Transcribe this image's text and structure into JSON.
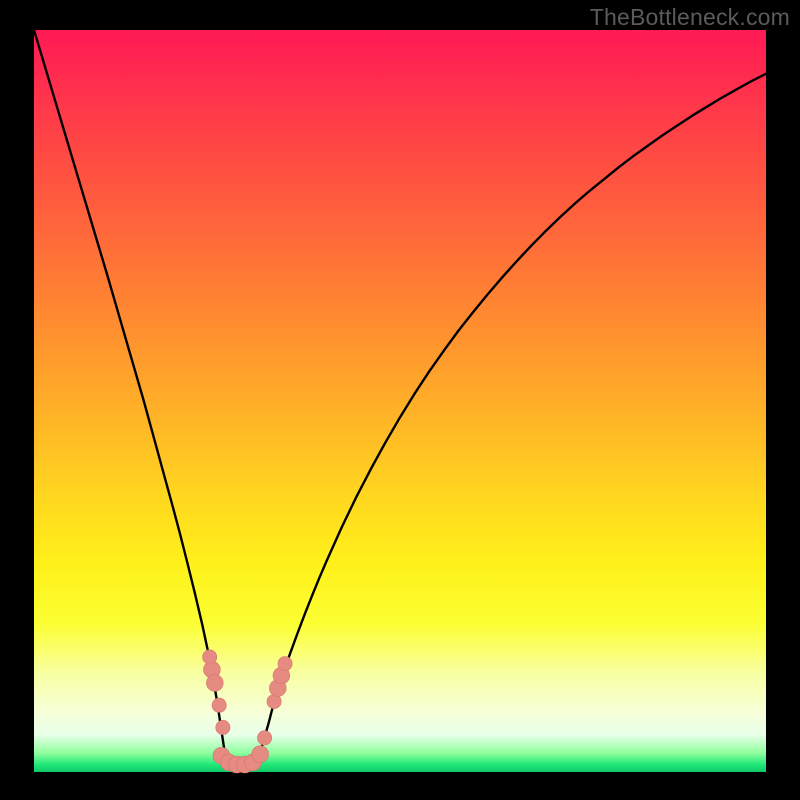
{
  "watermark": "TheBottleneck.com",
  "colors": {
    "frame": "#000000",
    "curve_stroke": "#000000",
    "marker_fill": "#e58b82",
    "marker_stroke": "#d8746b"
  },
  "chart_data": {
    "type": "line",
    "title": "",
    "xlabel": "",
    "ylabel": "",
    "xlim": [
      0,
      100
    ],
    "ylim": [
      0,
      100
    ],
    "grid": false,
    "x": [
      0,
      1,
      2,
      3,
      4,
      5,
      6,
      7,
      8,
      9,
      10,
      11,
      12,
      13,
      14,
      15,
      16,
      17,
      18,
      19,
      20,
      21,
      22,
      23,
      24,
      25,
      26,
      27,
      28,
      29,
      30,
      31,
      32,
      33,
      34,
      35,
      36,
      37,
      38,
      39,
      40,
      42,
      44,
      46,
      48,
      50,
      52,
      54,
      56,
      58,
      60,
      62,
      64,
      66,
      68,
      70,
      72,
      74,
      76,
      78,
      80,
      82,
      84,
      86,
      88,
      90,
      92,
      94,
      96,
      98,
      100
    ],
    "y": [
      100,
      96.7,
      93.4,
      90.1,
      86.8,
      83.5,
      80.2,
      76.9,
      73.6,
      70.3,
      67,
      63.6,
      60.2,
      56.8,
      53.4,
      50,
      46.4,
      42.8,
      39.2,
      35.6,
      31.9,
      28,
      24,
      19.8,
      15.2,
      9.6,
      3,
      1,
      1,
      1,
      1.6,
      3,
      6.4,
      10.2,
      13.2,
      16,
      18.7,
      21.3,
      23.8,
      26.2,
      28.5,
      32.9,
      37,
      40.8,
      44.4,
      47.8,
      51,
      54,
      56.8,
      59.5,
      62,
      64.4,
      66.7,
      68.9,
      71,
      73,
      74.9,
      76.7,
      78.4,
      80,
      81.6,
      83.1,
      84.5,
      85.9,
      87.2,
      88.5,
      89.7,
      90.9,
      92,
      93.1,
      94.1
    ],
    "markers": [
      {
        "x": 24.3,
        "y": 13.8,
        "r": 1.0
      },
      {
        "x": 24.7,
        "y": 12.0,
        "r": 1.0
      },
      {
        "x": 24.0,
        "y": 15.5,
        "r": 0.85
      },
      {
        "x": 25.3,
        "y": 9.0,
        "r": 0.85
      },
      {
        "x": 25.8,
        "y": 6.0,
        "r": 0.85
      },
      {
        "x": 25.6,
        "y": 2.2,
        "r": 1.0
      },
      {
        "x": 26.6,
        "y": 1.3,
        "r": 1.0
      },
      {
        "x": 27.7,
        "y": 1.0,
        "r": 1.0
      },
      {
        "x": 28.8,
        "y": 1.0,
        "r": 1.0
      },
      {
        "x": 29.9,
        "y": 1.3,
        "r": 1.0
      },
      {
        "x": 30.9,
        "y": 2.4,
        "r": 1.0
      },
      {
        "x": 31.5,
        "y": 4.6,
        "r": 0.85
      },
      {
        "x": 32.8,
        "y": 9.5,
        "r": 0.85
      },
      {
        "x": 33.3,
        "y": 11.3,
        "r": 1.0
      },
      {
        "x": 33.8,
        "y": 13.0,
        "r": 1.0
      },
      {
        "x": 34.3,
        "y": 14.6,
        "r": 0.85
      }
    ]
  }
}
